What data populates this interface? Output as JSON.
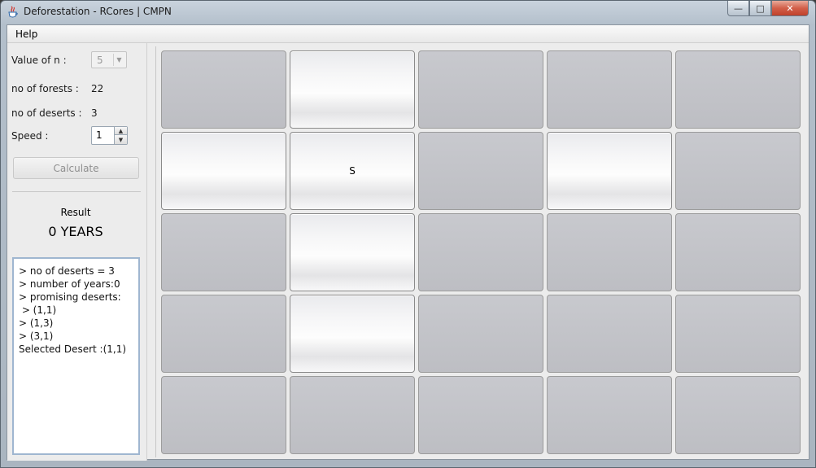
{
  "window": {
    "title": "Deforestation - RCores | CMPN",
    "minimize_glyph": "—",
    "maximize_glyph": "□",
    "close_glyph": "✕"
  },
  "menu": {
    "help": "Help"
  },
  "controls": {
    "n_label": "Value of n :",
    "n_value": "5",
    "forests_label": "no of forests :",
    "forests_value": "22",
    "deserts_label": "no of deserts :",
    "deserts_value": "3",
    "speed_label": "Speed :",
    "speed_value": "1",
    "calculate": "Calculate"
  },
  "result": {
    "label": "Result",
    "years": "0 YEARS"
  },
  "log": [
    "> no of deserts = 3",
    "> number of years:0",
    "> promising deserts:",
    " > (1,1)",
    "> (1,3)",
    "> (3,1)",
    "Selected Desert :(1,1)"
  ],
  "grid": {
    "rows": 5,
    "cols": 5,
    "cells": [
      [
        "",
        "",
        "",
        "",
        ""
      ],
      [
        "",
        "S",
        "",
        "",
        ""
      ],
      [
        "",
        "",
        "",
        "",
        ""
      ],
      [
        "",
        "",
        "",
        "",
        ""
      ],
      [
        "",
        "",
        "",
        "",
        ""
      ]
    ],
    "state": [
      [
        "desert",
        "forest",
        "desert",
        "desert",
        "desert"
      ],
      [
        "forest",
        "forest",
        "desert",
        "forest",
        "desert"
      ],
      [
        "desert",
        "forest",
        "desert",
        "desert",
        "desert"
      ],
      [
        "desert",
        "forest",
        "desert",
        "desert",
        "desert"
      ],
      [
        "desert",
        "desert",
        "desert",
        "desert",
        "desert"
      ]
    ]
  }
}
